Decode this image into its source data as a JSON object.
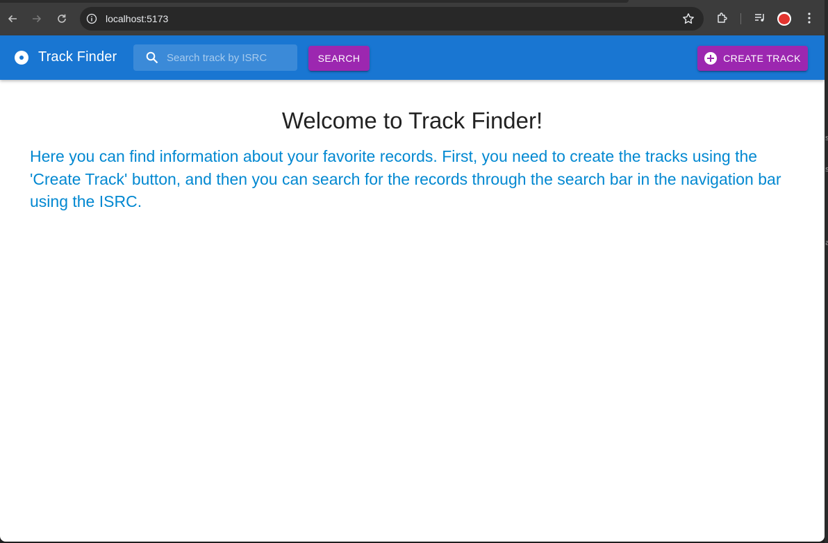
{
  "browser": {
    "url": "localhost:5173",
    "icons": [
      "back-icon",
      "forward-icon",
      "reload-icon",
      "info-icon",
      "bookmark-star-icon",
      "extensions-icon",
      "media-controls-icon",
      "profile-avatar",
      "menu-kebab-icon"
    ]
  },
  "appbar": {
    "title": "Track Finder",
    "search_placeholder": "Search track by ISRC",
    "search_button": "SEARCH",
    "create_button": "CREATE TRACK",
    "colors": {
      "bar": "#1976d2",
      "button": "#9c27b0"
    }
  },
  "main": {
    "heading": "Welcome to Track Finder!",
    "intro": "Here you can find information about your favorite records. First, you need to create the tracks using the 'Create Track' button, and then you can search for the records through the search bar in the navigation bar using the ISRC.",
    "intro_color": "#0288d1"
  }
}
